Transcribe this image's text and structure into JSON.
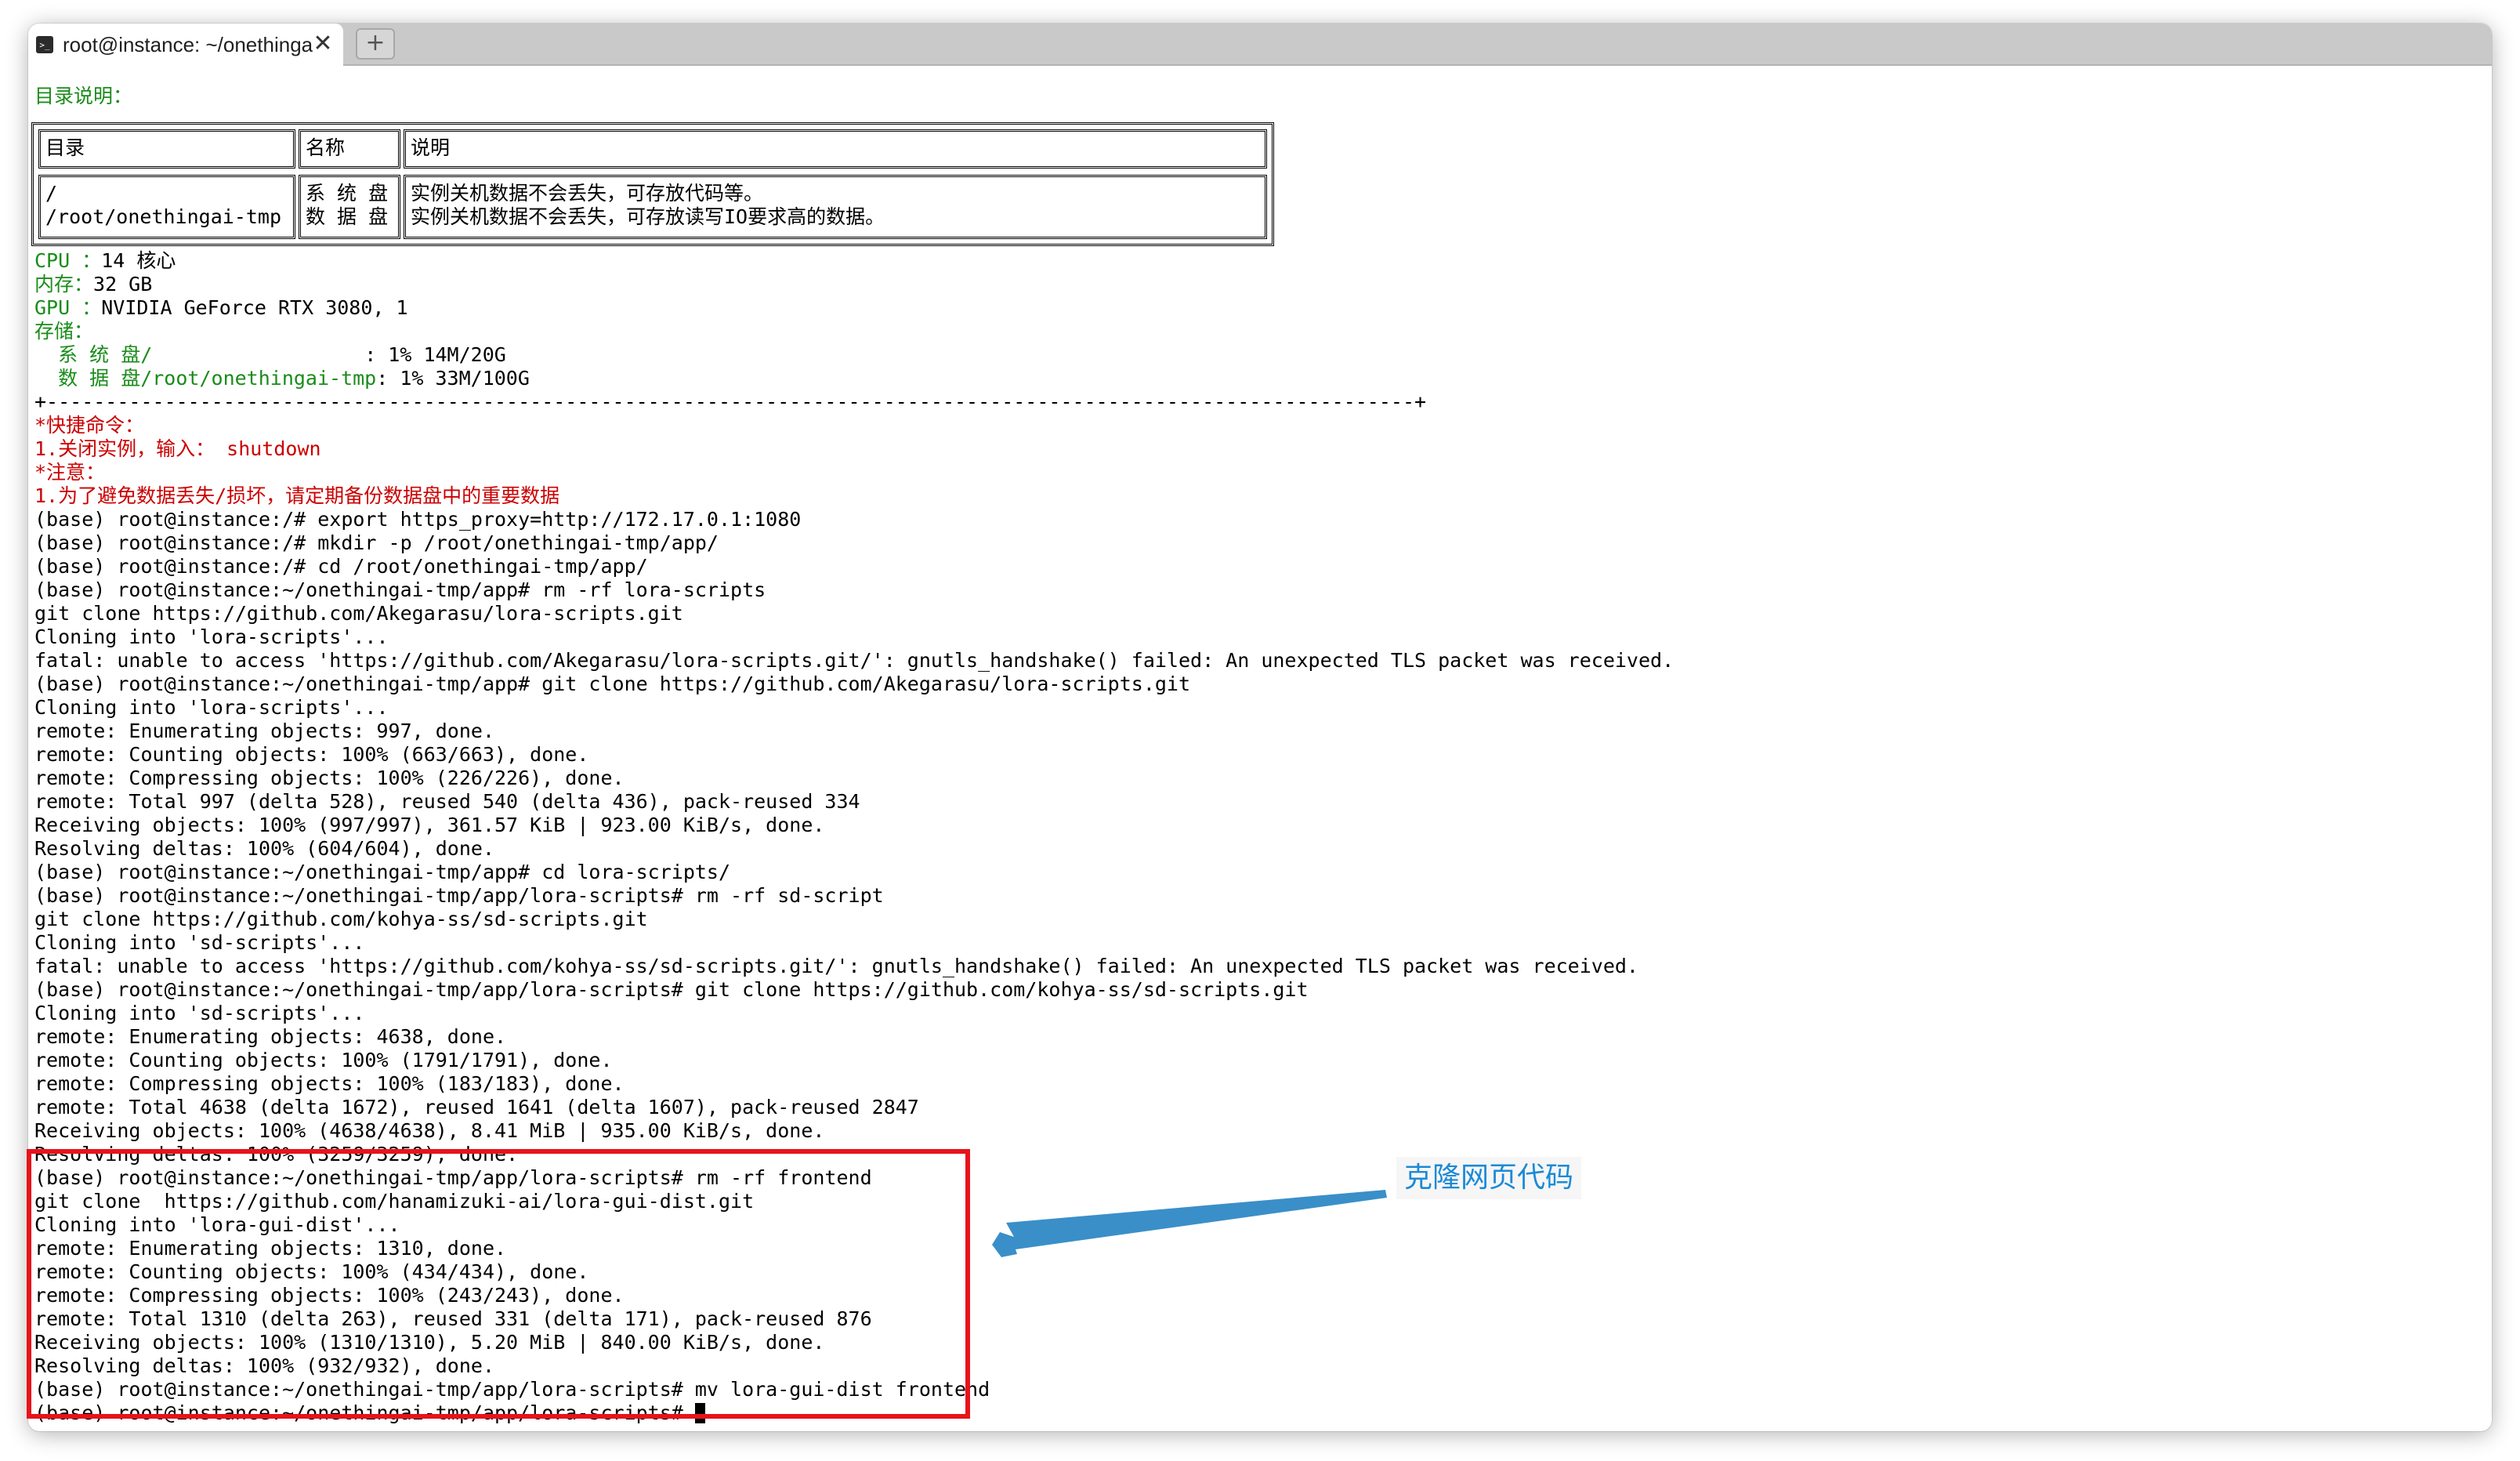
{
  "window": {
    "tab_title": "root@instance: ~/onethinga",
    "tab_icon": ">_",
    "close_glyph": "✕",
    "new_tab_glyph": "+"
  },
  "dir_table": {
    "heading": "目录说明：",
    "headers": [
      "目录",
      "名称",
      "说明"
    ],
    "rows": [
      [
        "/",
        "系 统 盘",
        "实例关机数据不会丢失，可存放代码等。"
      ],
      [
        "/root/onethingai-tmp",
        "数 据 盘",
        "实例关机数据不会丢失，可存放读写IO要求高的数据。"
      ]
    ]
  },
  "sys_info": {
    "cpu_label": "CPU ：",
    "cpu_value": "14 核心",
    "mem_label": "内存：",
    "mem_value": "32 GB",
    "gpu_label": "GPU ：",
    "gpu_value": "NVIDIA GeForce RTX 3080, 1",
    "storage_label": "存储：",
    "sys_disk_label": "  系 统 盘/                  ",
    "sys_disk_value": "1% 14M/20G",
    "data_disk_label": "  数 据 盘/root/onethingai-tmp",
    "data_disk_value": "1% 33M/100G",
    "separator": "+--------------------------------------------------------------------------------------------------------------------+"
  },
  "notices": [
    "*快捷命令：",
    "1.关闭实例，输入： shutdown",
    "*注意：",
    "1.为了避免数据丢失/损坏，请定期备份数据盘中的重要数据"
  ],
  "output_lines": [
    "(base) root@instance:/# export https_proxy=http://172.17.0.1:1080",
    "(base) root@instance:/# mkdir -p /root/onethingai-tmp/app/",
    "(base) root@instance:/# cd /root/onethingai-tmp/app/",
    "(base) root@instance:~/onethingai-tmp/app# rm -rf lora-scripts",
    "git clone https://github.com/Akegarasu/lora-scripts.git",
    "Cloning into 'lora-scripts'...",
    "fatal: unable to access 'https://github.com/Akegarasu/lora-scripts.git/': gnutls_handshake() failed: An unexpected TLS packet was received.",
    "(base) root@instance:~/onethingai-tmp/app# git clone https://github.com/Akegarasu/lora-scripts.git",
    "Cloning into 'lora-scripts'...",
    "remote: Enumerating objects: 997, done.",
    "remote: Counting objects: 100% (663/663), done.",
    "remote: Compressing objects: 100% (226/226), done.",
    "remote: Total 997 (delta 528), reused 540 (delta 436), pack-reused 334",
    "Receiving objects: 100% (997/997), 361.57 KiB | 923.00 KiB/s, done.",
    "Resolving deltas: 100% (604/604), done.",
    "(base) root@instance:~/onethingai-tmp/app# cd lora-scripts/",
    "(base) root@instance:~/onethingai-tmp/app/lora-scripts# rm -rf sd-script",
    "git clone https://github.com/kohya-ss/sd-scripts.git",
    "Cloning into 'sd-scripts'...",
    "fatal: unable to access 'https://github.com/kohya-ss/sd-scripts.git/': gnutls_handshake() failed: An unexpected TLS packet was received.",
    "(base) root@instance:~/onethingai-tmp/app/lora-scripts# git clone https://github.com/kohya-ss/sd-scripts.git",
    "Cloning into 'sd-scripts'...",
    "remote: Enumerating objects: 4638, done.",
    "remote: Counting objects: 100% (1791/1791), done.",
    "remote: Compressing objects: 100% (183/183), done.",
    "remote: Total 4638 (delta 1672), reused 1641 (delta 1607), pack-reused 2847",
    "Receiving objects: 100% (4638/4638), 8.41 MiB | 935.00 KiB/s, done.",
    "Resolving deltas: 100% (3259/3259), done.",
    "(base) root@instance:~/onethingai-tmp/app/lora-scripts# rm -rf frontend",
    "git clone  https://github.com/hanamizuki-ai/lora-gui-dist.git",
    "Cloning into 'lora-gui-dist'...",
    "remote: Enumerating objects: 1310, done.",
    "remote: Counting objects: 100% (434/434), done.",
    "remote: Compressing objects: 100% (243/243), done.",
    "remote: Total 1310 (delta 263), reused 331 (delta 171), pack-reused 876",
    "Receiving objects: 100% (1310/1310), 5.20 MiB | 840.00 KiB/s, done.",
    "Resolving deltas: 100% (932/932), done.",
    "(base) root@instance:~/onethingai-tmp/app/lora-scripts# mv lora-gui-dist frontend"
  ],
  "prompt_line": "(base) root@instance:~/onethingai-tmp/app/lora-scripts# ",
  "annotation": {
    "text": "克隆网页代码",
    "box_color": "#e8131b",
    "arrow_color": "#3a8fc8",
    "text_color": "#1b8ad6"
  }
}
